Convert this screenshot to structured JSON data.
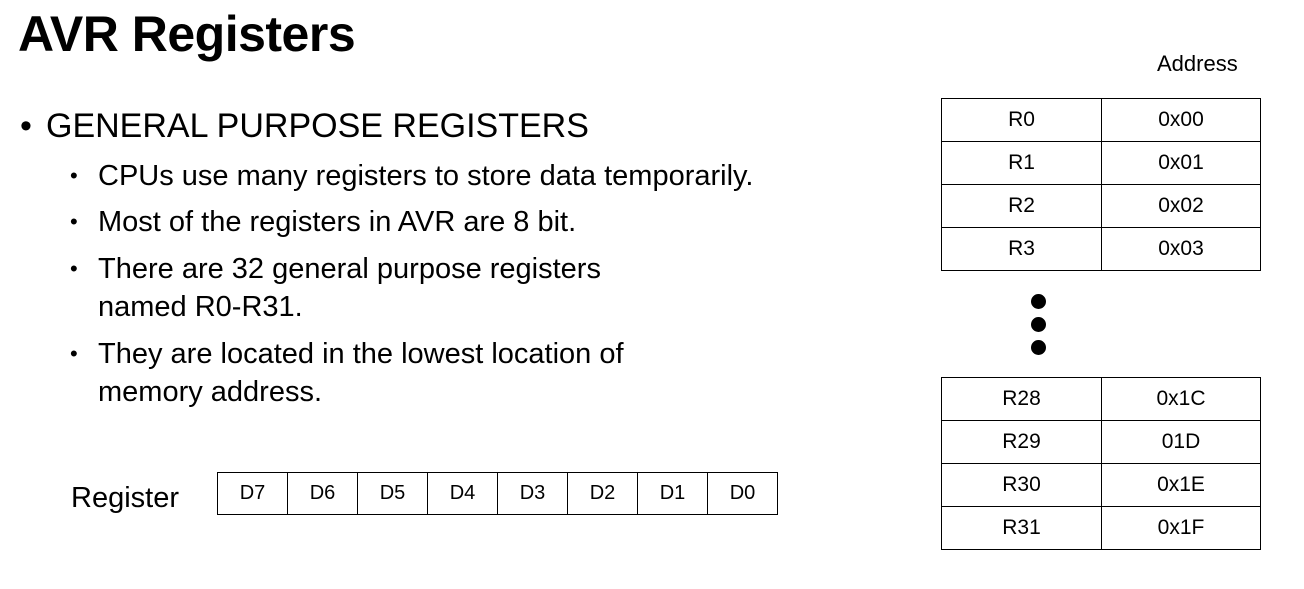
{
  "slide": {
    "title": "AVR Registers",
    "bullet_main": "GENERAL PURPOSE REGISTERS",
    "bullets": [
      "CPUs use many registers to store data temporarily.",
      "Most of the registers in AVR are 8 bit.",
      "There are 32 general purpose registers named R0-R31.",
      "They are located in the lowest location of memory address."
    ],
    "bullet_symbol": "•",
    "register_label": "Register",
    "bits": [
      "D7",
      "D6",
      "D5",
      "D4",
      "D3",
      "D2",
      "D1",
      "D0"
    ],
    "address_header": "Address",
    "registers_top": [
      {
        "name": "R0",
        "addr": "0x00"
      },
      {
        "name": "R1",
        "addr": "0x01"
      },
      {
        "name": "R2",
        "addr": "0x02"
      },
      {
        "name": "R3",
        "addr": "0x03"
      }
    ],
    "registers_bottom": [
      {
        "name": "R28",
        "addr": "0x1C"
      },
      {
        "name": "R29",
        "addr": "01D"
      },
      {
        "name": "R30",
        "addr": "0x1E"
      },
      {
        "name": "R31",
        "addr": "0x1F"
      }
    ]
  }
}
